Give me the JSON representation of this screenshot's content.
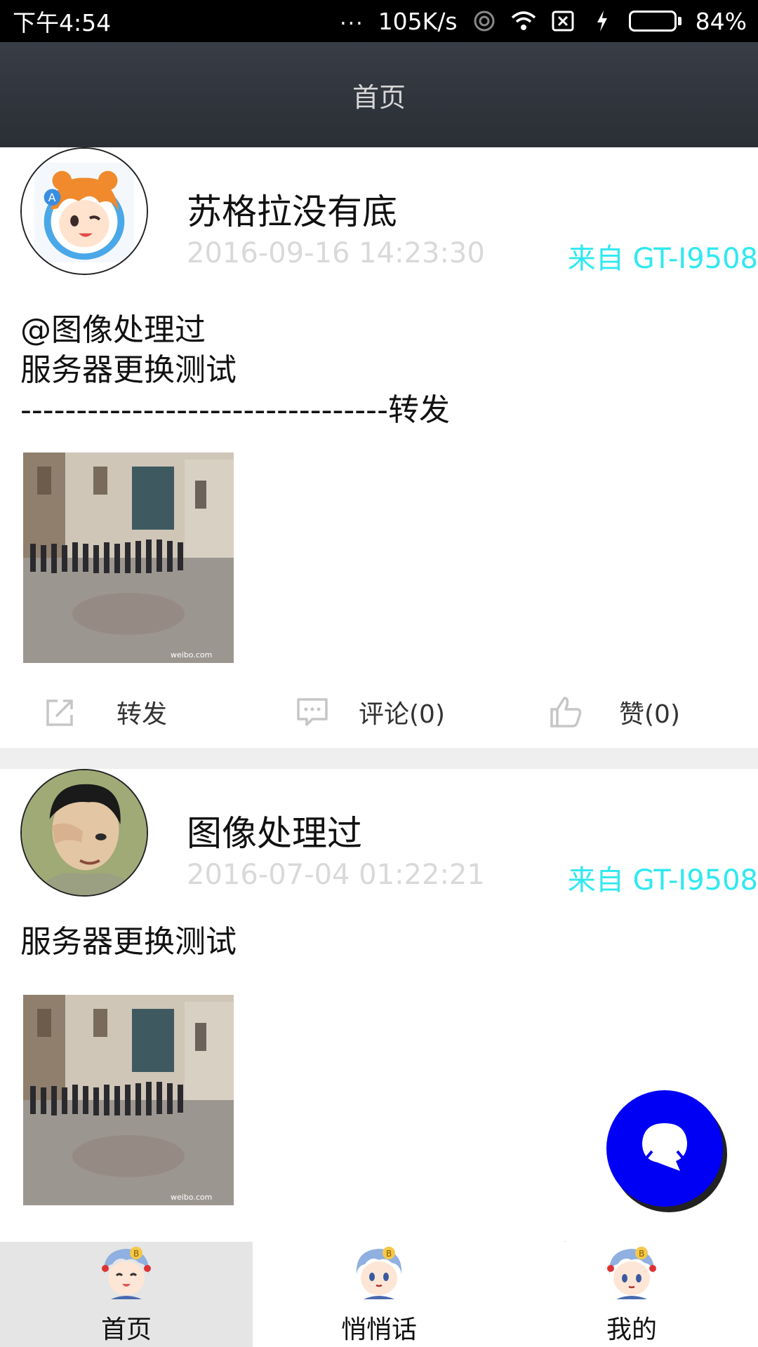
{
  "status_bar": {
    "time": "下午4:54",
    "dots": "...",
    "network_speed": "105K/s",
    "battery_percent": "84%",
    "battery_level": 0.84,
    "icons": [
      "hotspot-icon",
      "wifi-icon",
      "no-sim-icon",
      "charging-icon",
      "battery-icon"
    ]
  },
  "header": {
    "title": "首页"
  },
  "posts": [
    {
      "user_name": "苏格拉没有底",
      "time": "2016-09-16 14:23:30",
      "source": "来自 GT-I9508",
      "text": "@图像处理过\n服务器更换测试\n---------------------------------转发",
      "avatar": "anime-girl-avatar",
      "image": "street-group-photo",
      "actions": {
        "repost": "转发",
        "comment": "评论(0)",
        "like": "赞(0)"
      }
    },
    {
      "user_name": "图像处理过",
      "time": "2016-07-04 01:22:21",
      "source": "来自 GT-I9508",
      "text": "服务器更换测试",
      "avatar": "man-covering-eye-avatar",
      "image": "street-group-photo"
    }
  ],
  "fab": {
    "icon": "chat-bubble-icon"
  },
  "bottom_nav": {
    "items": [
      {
        "label": "首页",
        "active": true
      },
      {
        "label": "悄悄话",
        "active": false
      },
      {
        "label": "我的",
        "active": false
      }
    ]
  },
  "colors": {
    "source_text": "#2fe8f0",
    "fab": "#0000f5",
    "title_bar": "#30343b",
    "time_text": "#d9d9d9"
  }
}
